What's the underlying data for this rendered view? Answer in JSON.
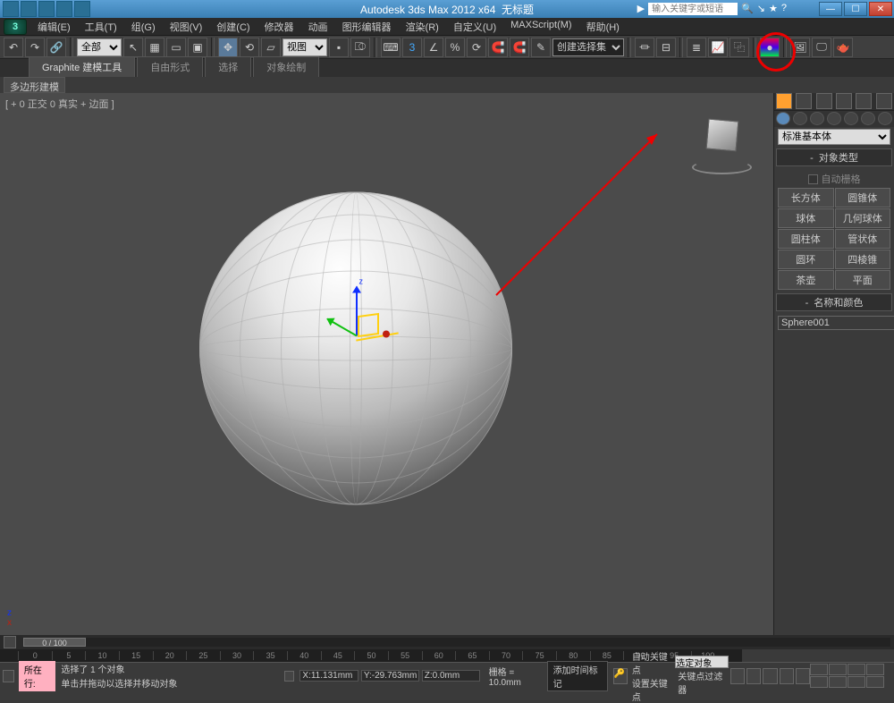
{
  "title": {
    "app": "Autodesk 3ds Max 2012 x64",
    "doc": "无标题",
    "search_ph": "输入关键字或短语"
  },
  "menu": [
    "编辑(E)",
    "工具(T)",
    "组(G)",
    "视图(V)",
    "创建(C)",
    "修改器",
    "动画",
    "图形编辑器",
    "渲染(R)",
    "自定义(U)",
    "MAXScript(M)",
    "帮助(H)"
  ],
  "toolbar": {
    "all_filter": "全部",
    "view_label": "视图",
    "selset": "创建选择集"
  },
  "ribbon": {
    "tabs": [
      "Graphite 建模工具",
      "自由形式",
      "选择",
      "对象绘制"
    ],
    "sub": "多边形建模"
  },
  "viewport": {
    "label": "[ + 0 正交 0 真实 + 边面 ]"
  },
  "cmdpanel": {
    "dropdown": "标准基本体",
    "rollup_type": "对象类型",
    "autogrid": "自动栅格",
    "buttons": [
      "长方体",
      "圆锥体",
      "球体",
      "几何球体",
      "圆柱体",
      "管状体",
      "圆环",
      "四棱锥",
      "茶壶",
      "平面"
    ],
    "rollup_name": "名称和颜色",
    "obj_name": "Sphere001"
  },
  "timeline": {
    "thumb": "0 / 100",
    "ticks": [
      "0",
      "5",
      "10",
      "15",
      "20",
      "25",
      "30",
      "35",
      "40",
      "45",
      "50",
      "55",
      "60",
      "65",
      "70",
      "75",
      "80",
      "85",
      "90",
      "95",
      "100"
    ]
  },
  "status": {
    "pink": "所在行:",
    "line1": "选择了 1 个对象",
    "line2": "单击并拖动以选择并移动对象",
    "x": "11.131mm",
    "y": "-29.763mm",
    "z": "0.0mm",
    "grid": "栅格 = 10.0mm",
    "add_time": "添加时间标记",
    "autokey": "自动关键点",
    "setkey": "设置关键点",
    "selobj": "选定对象",
    "keyfilt": "关键点过滤器"
  }
}
